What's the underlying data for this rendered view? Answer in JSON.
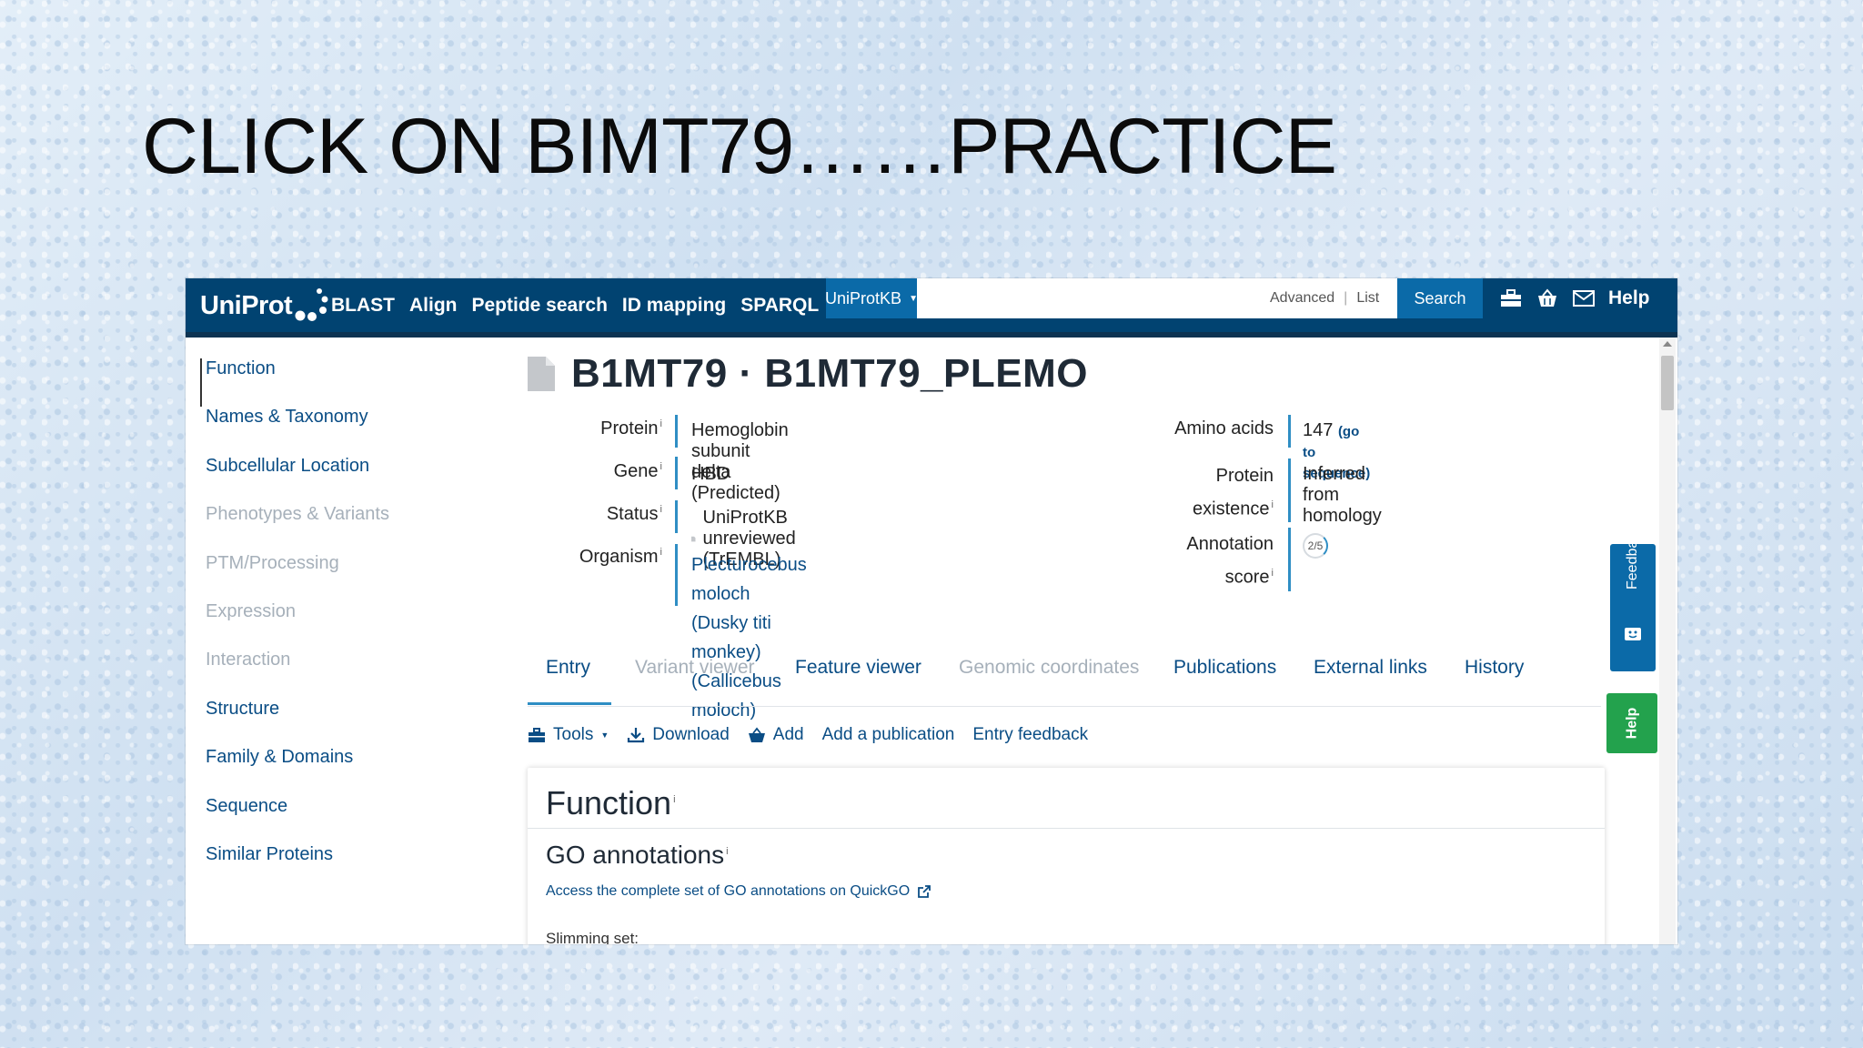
{
  "slide": {
    "title": "CLICK ON BIMT79……PRACTICE"
  },
  "header": {
    "logo": "UniProt",
    "nav": [
      "BLAST",
      "Align",
      "Peptide search",
      "ID mapping",
      "SPARQL"
    ],
    "database": "UniProtKB",
    "search_value": "",
    "advanced": "Advanced",
    "list": "List",
    "search_button": "Search",
    "help": "Help"
  },
  "sidebar": {
    "items": [
      {
        "label": "Function",
        "state": "active"
      },
      {
        "label": "Names & Taxonomy",
        "state": "enabled"
      },
      {
        "label": "Subcellular Location",
        "state": "enabled"
      },
      {
        "label": "Phenotypes & Variants",
        "state": "disabled"
      },
      {
        "label": "PTM/Processing",
        "state": "disabled"
      },
      {
        "label": "Expression",
        "state": "disabled"
      },
      {
        "label": "Interaction",
        "state": "disabled"
      },
      {
        "label": "Structure",
        "state": "enabled"
      },
      {
        "label": "Family & Domains",
        "state": "enabled"
      },
      {
        "label": "Sequence",
        "state": "enabled"
      },
      {
        "label": "Similar Proteins",
        "state": "enabled"
      }
    ]
  },
  "entry": {
    "title": "B1MT79 · B1MT79_PLEMO",
    "protein_label": "Protein",
    "protein": "Hemoglobin subunit delta (Predicted)",
    "gene_label": "Gene",
    "gene": "HBD",
    "status_label": "Status",
    "status": "UniProtKB unreviewed (TrEMBL)",
    "organism_label": "Organism",
    "organism_line1": "Plecturocebus moloch (Dusky titi monkey)",
    "organism_line2": "(Callicebus moloch)",
    "amino_label": "Amino acids",
    "amino_value": "147",
    "amino_link": "(go to sequence)",
    "existence_label_1": "Protein",
    "existence_label_2": "existence",
    "existence": "Inferred from homology",
    "annotation_label_1": "Annotation",
    "annotation_label_2": "score",
    "annotation_score": "2/5",
    "annotation_score_fraction": 0.4
  },
  "tabs": [
    {
      "label": "Entry",
      "state": "active"
    },
    {
      "label": "Variant viewer",
      "state": "disabled"
    },
    {
      "label": "Feature viewer",
      "state": "enabled"
    },
    {
      "label": "Genomic coordinates",
      "state": "disabled"
    },
    {
      "label": "Publications",
      "state": "enabled"
    },
    {
      "label": "External links",
      "state": "enabled"
    },
    {
      "label": "History",
      "state": "enabled"
    }
  ],
  "toolbar": {
    "tools": "Tools",
    "download": "Download",
    "add": "Add",
    "add_publication": "Add a publication",
    "entry_feedback": "Entry feedback"
  },
  "function_card": {
    "heading": "Function",
    "go_heading": "GO annotations",
    "quickgo_link": "Access the complete set of GO annotations on QuickGO",
    "slimming": "Slimming set:"
  },
  "side_tabs": {
    "feedback": "Feedback",
    "help": "Help"
  },
  "colors": {
    "header_bg": "#014371",
    "accent": "#2f8ec4",
    "link": "#0a4d85",
    "help_green": "#23a24d"
  }
}
